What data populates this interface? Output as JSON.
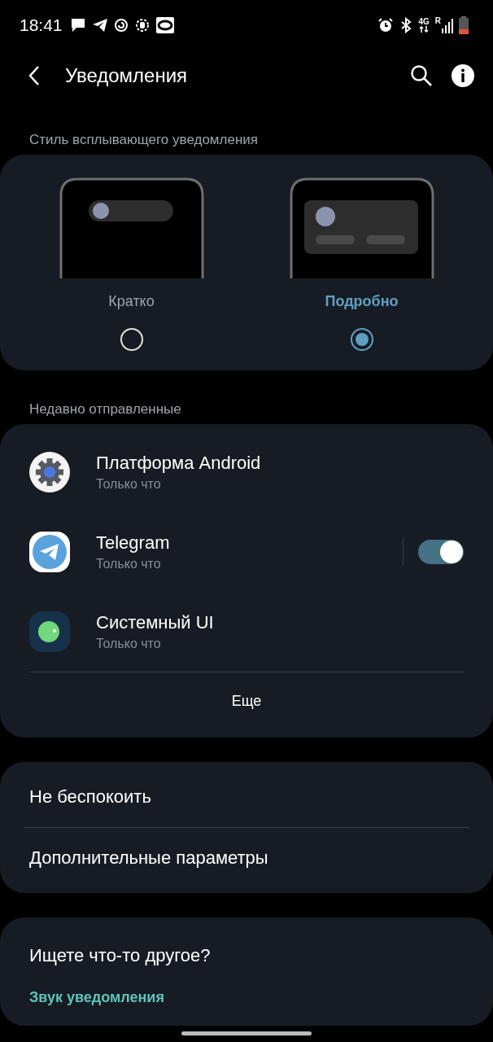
{
  "status_bar": {
    "time": "18:41",
    "network": "4G",
    "roaming": "R"
  },
  "header": {
    "title": "Уведомления"
  },
  "popup_style": {
    "heading": "Стиль всплывающего уведомления",
    "options": [
      {
        "kind": "brief",
        "label": "Кратко",
        "selected": false
      },
      {
        "kind": "detailed",
        "label": "Подробно",
        "selected": true
      }
    ]
  },
  "recent": {
    "heading": "Недавно отправленные",
    "apps": [
      {
        "kind": "gear",
        "name": "Платформа Android",
        "time": "Только что"
      },
      {
        "kind": "telegram",
        "name": "Telegram",
        "time": "Только что",
        "switch": {
          "on": true
        }
      },
      {
        "kind": "system",
        "name": "Системный UI",
        "time": "Только что"
      }
    ],
    "more": "Еще"
  },
  "settings": [
    "Не беспокоить",
    "Дополнительные параметры"
  ],
  "suggestion": {
    "title": "Ищете что-то другое?",
    "link": "Звук уведомления"
  }
}
